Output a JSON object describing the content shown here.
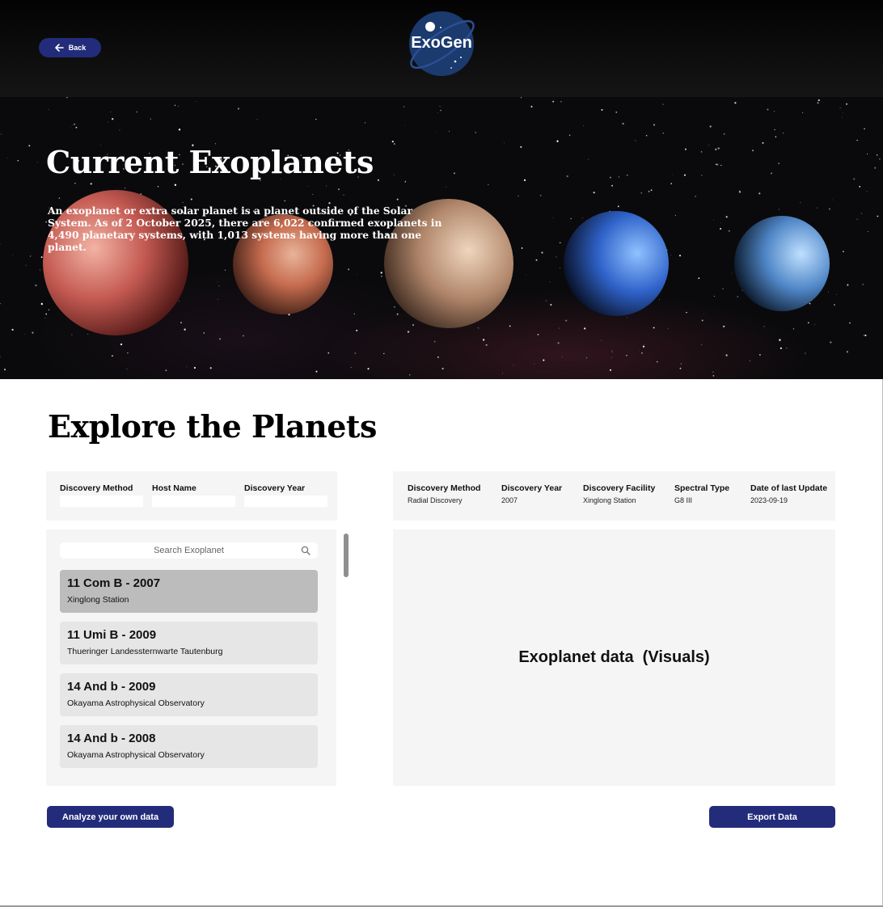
{
  "header": {
    "back_label": "Back",
    "logo_text": "ExoGen"
  },
  "hero": {
    "title": "Current Exoplanets",
    "description": "An exoplanet or extra solar planet is a planet outside of the Solar System. As of 2 October 2025, there are 6,022 confirmed exoplanets in 4,490 planetary systems, with 1,013 systems having more than one planet."
  },
  "explore": {
    "title": "Explore the Planets"
  },
  "filters": [
    {
      "label": "Discovery Method",
      "value": ""
    },
    {
      "label": "Host Name",
      "value": ""
    },
    {
      "label": "Discovery Year",
      "value": ""
    }
  ],
  "search": {
    "placeholder": "Search Exoplanet"
  },
  "planets": [
    {
      "name": "11 Com B - 2007",
      "facility": "Xinglong Station",
      "selected": true
    },
    {
      "name": "11 Umi B - 2009",
      "facility": "Thueringer Landessternwarte Tautenburg",
      "selected": false
    },
    {
      "name": "14 And b - 2009",
      "facility": "Okayama Astrophysical Observatory",
      "selected": false
    },
    {
      "name": "14 And b - 2008",
      "facility": "Okayama Astrophysical Observatory",
      "selected": false
    }
  ],
  "details": [
    {
      "label": "Discovery Method",
      "value": "Radial Discovery"
    },
    {
      "label": "Discovery Year",
      "value": "2007"
    },
    {
      "label": "Discovery Facility",
      "value": "Xinglong Station"
    },
    {
      "label": "Spectral Type",
      "value": "G8 III"
    },
    {
      "label": "Date of last Update",
      "value": "2023-09-19"
    }
  ],
  "visuals": {
    "placeholder": "Exoplanet data  (Visuals)"
  },
  "actions": {
    "analyze_label": "Analyze your own data",
    "export_label": "Export Data"
  },
  "colors": {
    "accent": "#232c7a",
    "panel": "#f5f5f5",
    "selected_item": "#bcbcbc",
    "item": "#e6e6e6"
  }
}
